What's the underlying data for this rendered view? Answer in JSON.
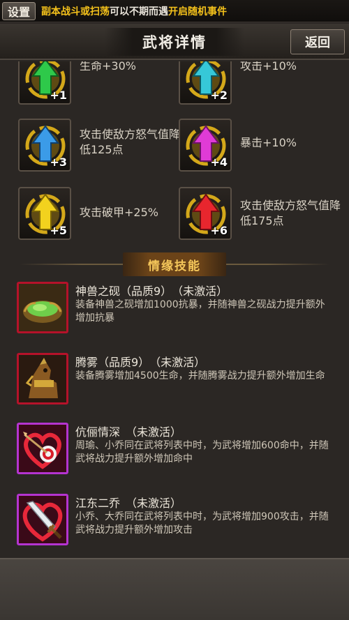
{
  "notice": {
    "settings_label": "设置",
    "part1": "副本战斗或扫荡",
    "part2": "可以不期而遇",
    "part3": "开启随机事件"
  },
  "header": {
    "title": "武将详情",
    "back_label": "返回"
  },
  "bonuses": [
    {
      "level": "+1",
      "text": "生命+30%",
      "color": "#2ec94a",
      "icon": "green-arrow-icon"
    },
    {
      "level": "+2",
      "text": "攻击+10%",
      "color": "#36c8d8",
      "icon": "cyan-arrow-icon"
    },
    {
      "level": "+3",
      "text": "攻击使敌方怒气值降低125点",
      "color": "#3b9be8",
      "icon": "blue-arrow-icon"
    },
    {
      "level": "+4",
      "text": "暴击+10%",
      "color": "#e03bd6",
      "icon": "magenta-arrow-icon"
    },
    {
      "level": "+5",
      "text": "攻击破甲+25%",
      "color": "#f2d21e",
      "icon": "yellow-arrow-icon"
    },
    {
      "level": "+6",
      "text": "攻击使敌方怒气值降低175点",
      "color": "#e8262e",
      "icon": "red-arrow-icon"
    }
  ],
  "section": {
    "title": "情缘技能"
  },
  "skills": [
    {
      "name": "神兽之砚（品质9）　（未激活）",
      "desc": "装备神兽之砚增加1000抗暴，并随神兽之砚战力提升额外增加抗暴",
      "icon": "jade-inkstone-icon"
    },
    {
      "name": "腾雾（品质9）　（未激活）",
      "desc": "装备腾雾增加4500生命，并随腾雾战力提升额外增加生命",
      "icon": "war-horse-icon"
    },
    {
      "name": "伉俪情深　（未激活）",
      "desc": "周瑜、小乔同在武将列表中时，为武将增加600命中，并随武将战力提升额外增加命中",
      "icon": "heart-arrow-target-icon"
    },
    {
      "name": "江东二乔　（未激活）",
      "desc": "小乔、大乔同在武将列表中时，为武将增加900攻击，并随武将战力提升额外增加攻击",
      "icon": "heart-sword-icon"
    }
  ]
}
